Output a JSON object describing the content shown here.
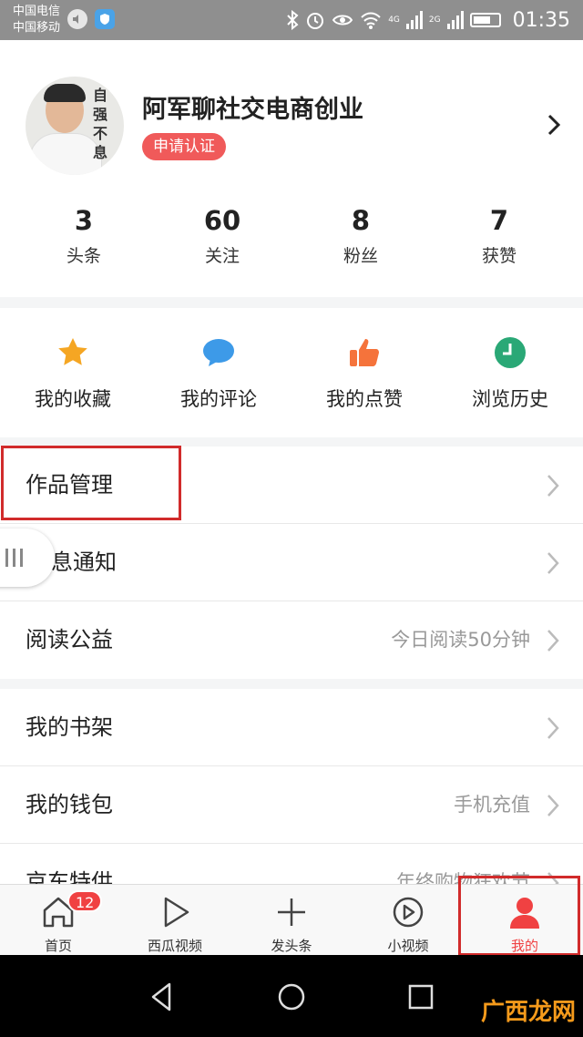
{
  "status_bar": {
    "carrier1": "中国电信",
    "carrier2": "中国移动",
    "network_4g": "4G",
    "network_2g": "2G",
    "time": "01:35"
  },
  "profile": {
    "name": "阿军聊社交电商创业",
    "verify_label": "申请认证",
    "avatar_calligraphy": "自强不息",
    "stats": [
      {
        "value": "3",
        "label": "头条"
      },
      {
        "value": "60",
        "label": "关注"
      },
      {
        "value": "8",
        "label": "粉丝"
      },
      {
        "value": "7",
        "label": "获赞"
      }
    ]
  },
  "quick_actions": [
    {
      "label": "我的收藏",
      "icon": "star-icon",
      "color": "#f5a623"
    },
    {
      "label": "我的评论",
      "icon": "comment-icon",
      "color": "#3d9ae8"
    },
    {
      "label": "我的点赞",
      "icon": "thumbs-up-icon",
      "color": "#f5733b"
    },
    {
      "label": "浏览历史",
      "icon": "clock-icon",
      "color": "#2aa876"
    }
  ],
  "menu_group1": [
    {
      "title": "作品管理",
      "sub": ""
    },
    {
      "title": "息通知",
      "sub": ""
    },
    {
      "title": "阅读公益",
      "sub": "今日阅读50分钟"
    }
  ],
  "menu_group2": [
    {
      "title": "我的书架",
      "sub": ""
    },
    {
      "title": "我的钱包",
      "sub": "手机充值"
    },
    {
      "title": "京东特供",
      "sub": "年终购物狂欢节"
    }
  ],
  "tabs": [
    {
      "label": "首页",
      "icon": "home-icon",
      "badge": "12"
    },
    {
      "label": "西瓜视频",
      "icon": "play-icon"
    },
    {
      "label": "发头条",
      "icon": "plus-icon"
    },
    {
      "label": "小视频",
      "icon": "mini-video-icon"
    },
    {
      "label": "我的",
      "icon": "user-icon"
    }
  ],
  "watermark": "广西龙网",
  "colors": {
    "accent": "#f04142",
    "highlight_box": "#d12b2b"
  }
}
